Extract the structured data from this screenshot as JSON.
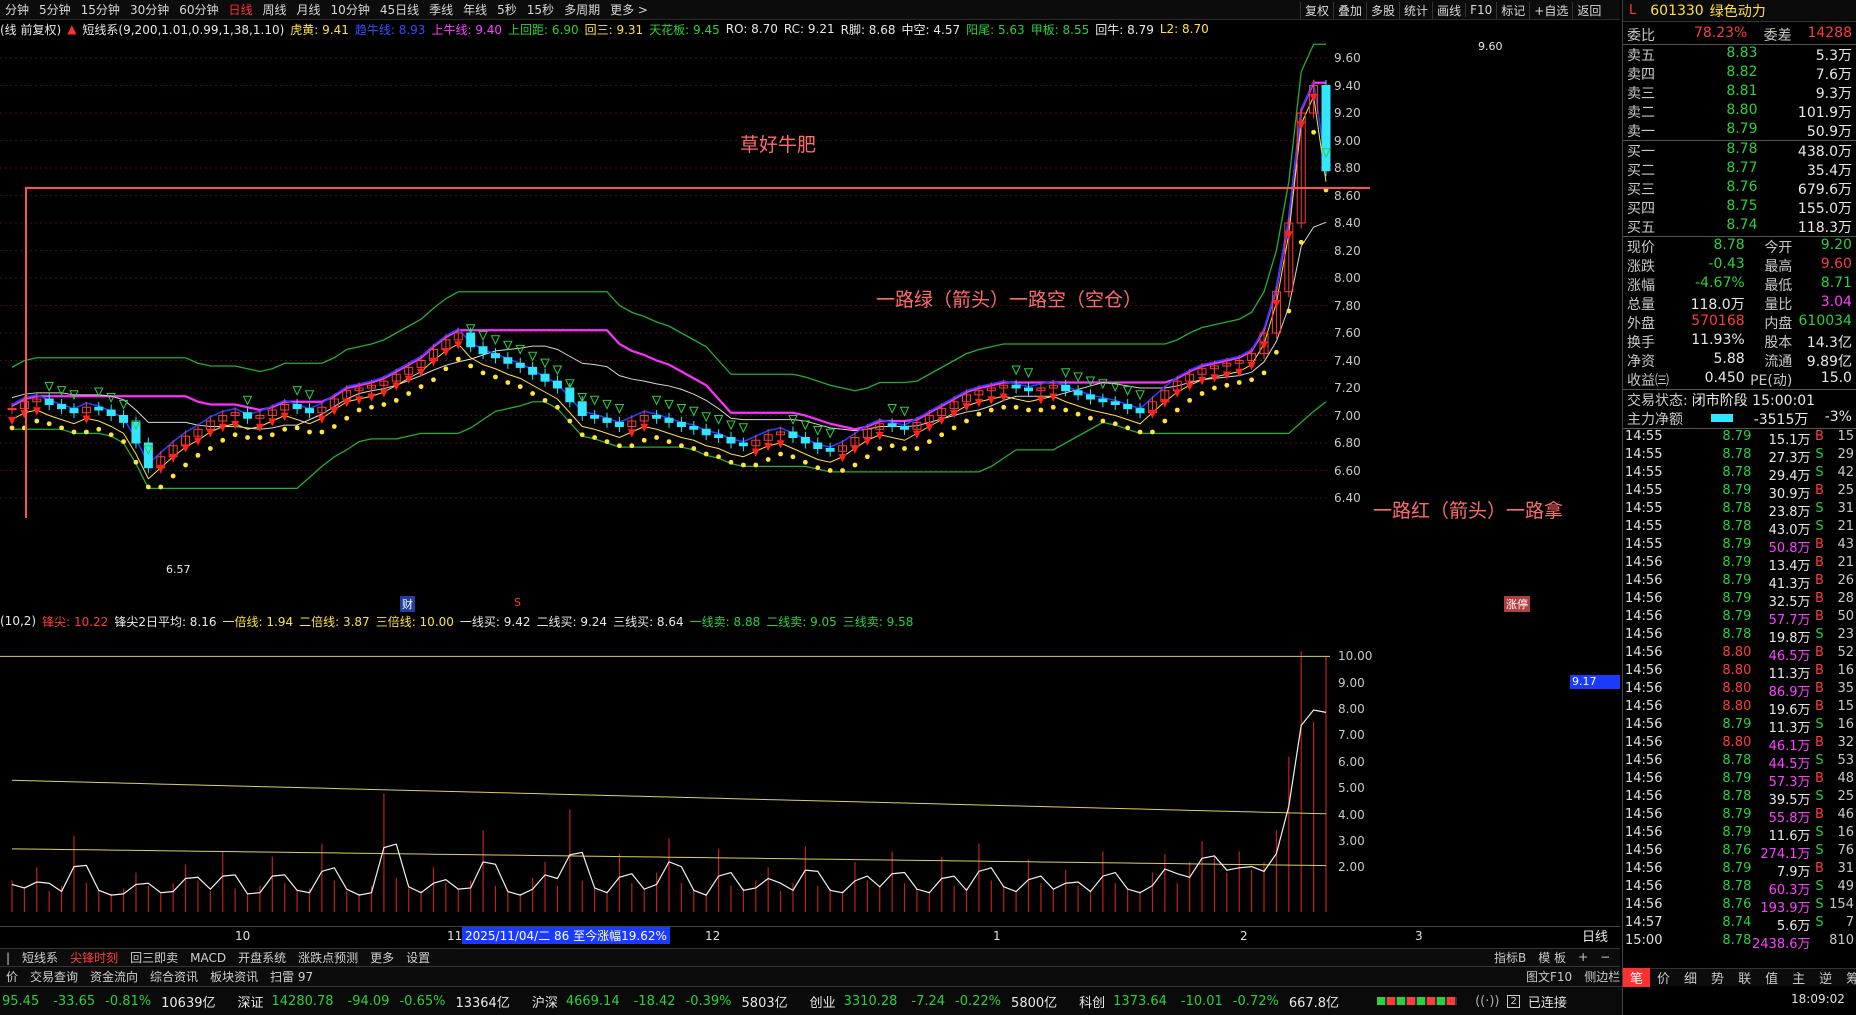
{
  "topbar": {
    "periods": [
      "分钟",
      "5分钟",
      "15分钟",
      "30分钟",
      "60分钟",
      "日线",
      "周线",
      "月线",
      "10分钟",
      "45日线",
      "季线",
      "年线",
      "5秒",
      "15秒",
      "多周期",
      "更多 >"
    ],
    "active_period": "日线",
    "right_tools": [
      "复权",
      "叠加",
      "多股",
      "统计",
      "画线",
      "F10",
      "标记",
      "+自选",
      "返回"
    ]
  },
  "main_indicator": {
    "prefix": "(线 前复权)",
    "name": "短线系(9,200,1.01,0.99,1,38,1.10)",
    "items": [
      {
        "label": "虎黄:",
        "value": "9.41",
        "color": "#ffe33b"
      },
      {
        "label": "趋牛线:",
        "value": "8.93",
        "color": "#3050ff"
      },
      {
        "label": "上牛线:",
        "value": "9.40",
        "color": "#ff40ff"
      },
      {
        "label": "上回距:",
        "value": "6.90",
        "color": "#28d23c"
      },
      {
        "label": "回三:",
        "value": "9.31",
        "color": "#ffe33b"
      },
      {
        "label": "天花板:",
        "value": "9.45",
        "color": "#28d23c"
      },
      {
        "label": "RO:",
        "value": "8.70",
        "color": "#e8e8e8"
      },
      {
        "label": "RC:",
        "value": "9.21",
        "color": "#e8e8e8"
      },
      {
        "label": "R脚:",
        "value": "8.68",
        "color": "#e8e8e8"
      },
      {
        "label": "中空:",
        "value": "4.57",
        "color": "#e8e8e8"
      },
      {
        "label": "阳尾:",
        "value": "5.63",
        "color": "#28d23c"
      },
      {
        "label": "甲板:",
        "value": "8.55",
        "color": "#28d23c"
      },
      {
        "label": "回牛:",
        "value": "8.79",
        "color": "#e8e8e8"
      },
      {
        "label": "L2:",
        "value": "8.70",
        "color": "#ffe33b"
      }
    ]
  },
  "annotations": {
    "title": "草好牛肥",
    "green_text": "一路绿（箭头）一路空（空仓）",
    "red_text": "一路红（箭头）一路拿",
    "high_label": "9.60",
    "low_label": "6.57",
    "limit_tag": "涨停",
    "cai": "财",
    "s_mark": "S"
  },
  "price_axis": [
    "9.60",
    "9.40",
    "9.20",
    "9.00",
    "8.80",
    "8.60",
    "8.40",
    "8.20",
    "8.00",
    "7.80",
    "7.60",
    "7.40",
    "7.20",
    "7.00",
    "6.80",
    "6.60",
    "6.40"
  ],
  "sub_indicator": {
    "prefix": "(10,2)",
    "items": [
      {
        "label": "锋尖:",
        "value": "10.22",
        "color": "#ff3b3b"
      },
      {
        "label": "锋尖2日平均:",
        "value": "8.16",
        "color": "#e8e8e8"
      },
      {
        "label": "一倍线:",
        "value": "1.94",
        "color": "#ffe33b"
      },
      {
        "label": "二倍线:",
        "value": "3.87",
        "color": "#ffe33b"
      },
      {
        "label": "三倍线:",
        "value": "10.00",
        "color": "#ffe33b"
      },
      {
        "label": "一线买:",
        "value": "9.42",
        "color": "#e8e8e8"
      },
      {
        "label": "二线买:",
        "value": "9.24",
        "color": "#e8e8e8"
      },
      {
        "label": "三线买:",
        "value": "8.64",
        "color": "#e8e8e8"
      },
      {
        "label": "一线卖:",
        "value": "8.88",
        "color": "#28d23c"
      },
      {
        "label": "二线卖:",
        "value": "9.05",
        "color": "#28d23c"
      },
      {
        "label": "三线卖:",
        "value": "9.58",
        "color": "#28d23c"
      }
    ],
    "axis": [
      "10.00",
      "9.00",
      "8.00",
      "7.00",
      "6.00",
      "5.00",
      "4.00",
      "3.00",
      "2.00"
    ],
    "current": "9.17"
  },
  "xaxis": {
    "months": [
      "10",
      "11",
      "12",
      "1",
      "2",
      "3"
    ],
    "info": "2025/11/04/二 86 至今涨幅19.62%",
    "period_label": "日线"
  },
  "bottom_tabs1": [
    "短线系",
    "尖锋时刻",
    "回三即卖",
    "MACD",
    "开盘系统",
    "涨跌点预测",
    "更多",
    "设置"
  ],
  "bottom_tabs1_active": "尖锋时刻",
  "bottom_tabs1_right": [
    "指标B",
    "模 板",
    "+",
    "−"
  ],
  "bottom_tabs2": [
    "价",
    "交易查询",
    "资金流向",
    "综合资讯",
    "板块资讯",
    "扫雷 97"
  ],
  "bottom_tabs2_right": [
    "图文F10",
    "侧边栏"
  ],
  "quote": {
    "code": "601330",
    "name": "绿色动力",
    "webi": {
      "label": "委比",
      "value": "78.23%",
      "diff_label": "委差",
      "diff": "14288"
    },
    "asks": [
      {
        "label": "卖五",
        "price": "8.83",
        "vol": "5.3万"
      },
      {
        "label": "卖四",
        "price": "8.82",
        "vol": "7.6万"
      },
      {
        "label": "卖三",
        "price": "8.81",
        "vol": "9.3万"
      },
      {
        "label": "卖二",
        "price": "8.80",
        "vol": "101.9万"
      },
      {
        "label": "卖一",
        "price": "8.79",
        "vol": "50.9万"
      }
    ],
    "bids": [
      {
        "label": "买一",
        "price": "8.78",
        "vol": "438.0万"
      },
      {
        "label": "买二",
        "price": "8.77",
        "vol": "35.4万"
      },
      {
        "label": "买三",
        "price": "8.76",
        "vol": "679.6万"
      },
      {
        "label": "买四",
        "price": "8.75",
        "vol": "155.0万"
      },
      {
        "label": "买五",
        "price": "8.74",
        "vol": "118.3万"
      }
    ],
    "stats": [
      [
        "现价",
        "8.78",
        "今开",
        "9.20"
      ],
      [
        "涨跌",
        "-0.43",
        "最高",
        "9.60"
      ],
      [
        "涨幅",
        "-4.67%",
        "最低",
        "8.71"
      ],
      [
        "总量",
        "118.0万",
        "量比",
        "3.04"
      ],
      [
        "外盘",
        "570168",
        "内盘",
        "610034"
      ],
      [
        "换手",
        "11.93%",
        "股本",
        "14.3亿"
      ],
      [
        "净资",
        "5.88",
        "流通",
        "9.89亿"
      ],
      [
        "收益㈢",
        "0.450",
        "PE(动)",
        "15.0"
      ]
    ],
    "status_label": "交易状态:",
    "status": "闭市阶段 15:00:01",
    "main_flow_label": "主力净额",
    "main_flow": "-3515万",
    "main_flow_pct": "-3%",
    "ticks": [
      [
        "14:55",
        "8.79",
        "15.1万",
        "B",
        "15"
      ],
      [
        "14:55",
        "8.78",
        "27.3万",
        "S",
        "29"
      ],
      [
        "14:55",
        "8.78",
        "29.4万",
        "S",
        "42"
      ],
      [
        "14:55",
        "8.79",
        "30.9万",
        "B",
        "25"
      ],
      [
        "14:55",
        "8.78",
        "23.8万",
        "S",
        "31"
      ],
      [
        "14:55",
        "8.78",
        "43.0万",
        "S",
        "21"
      ],
      [
        "14:55",
        "8.79",
        "50.8万",
        "B",
        "43"
      ],
      [
        "14:56",
        "8.79",
        "13.4万",
        "B",
        "21"
      ],
      [
        "14:56",
        "8.79",
        "41.3万",
        "B",
        "26"
      ],
      [
        "14:56",
        "8.79",
        "32.5万",
        "B",
        "28"
      ],
      [
        "14:56",
        "8.79",
        "57.7万",
        "B",
        "50"
      ],
      [
        "14:56",
        "8.78",
        "19.8万",
        "S",
        "23"
      ],
      [
        "14:56",
        "8.80",
        "46.5万",
        "B",
        "52"
      ],
      [
        "14:56",
        "8.80",
        "11.3万",
        "B",
        "16"
      ],
      [
        "14:56",
        "8.80",
        "86.9万",
        "B",
        "35"
      ],
      [
        "14:56",
        "8.80",
        "19.6万",
        "B",
        "15"
      ],
      [
        "14:56",
        "8.79",
        "11.3万",
        "S",
        "16"
      ],
      [
        "14:56",
        "8.80",
        "46.1万",
        "B",
        "32"
      ],
      [
        "14:56",
        "8.78",
        "44.5万",
        "S",
        "53"
      ],
      [
        "14:56",
        "8.79",
        "57.3万",
        "B",
        "48"
      ],
      [
        "14:56",
        "8.78",
        "39.5万",
        "S",
        "25"
      ],
      [
        "14:56",
        "8.79",
        "55.8万",
        "B",
        "46"
      ],
      [
        "14:56",
        "8.79",
        "11.6万",
        "S",
        "16"
      ],
      [
        "14:56",
        "8.76",
        "274.1万",
        "S",
        "76"
      ],
      [
        "14:56",
        "8.79",
        "7.9万",
        "B",
        "31"
      ],
      [
        "14:56",
        "8.78",
        "60.3万",
        "S",
        "49"
      ],
      [
        "14:56",
        "8.76",
        "193.9万",
        "S",
        "154"
      ],
      [
        "14:57",
        "8.74",
        "5.6万",
        "S",
        "7"
      ],
      [
        "15:00",
        "8.78",
        "2438.6万",
        "",
        "810"
      ]
    ],
    "bottom_tabs": [
      "笔",
      "价",
      "细",
      "势",
      "联",
      "值",
      "主",
      "逆",
      "筹"
    ]
  },
  "indices": [
    {
      "name": "",
      "value": "95.45",
      "chg": "-33.65",
      "pct": "-0.81%",
      "amt": "10639亿"
    },
    {
      "name": "深证",
      "value": "14280.78",
      "chg": "-94.09",
      "pct": "-0.65%",
      "amt": "13364亿"
    },
    {
      "name": "沪深",
      "value": "4669.14",
      "chg": "-18.42",
      "pct": "-0.39%",
      "amt": "5803亿"
    },
    {
      "name": "创业",
      "value": "3310.28",
      "chg": "-7.24",
      "pct": "-0.22%",
      "amt": "5800亿"
    },
    {
      "name": "科创",
      "value": "1373.64",
      "chg": "-10.01",
      "pct": "-0.72%",
      "amt": "667.8亿"
    }
  ],
  "connection": "已连接",
  "clock": "18:09:02",
  "chart_data": {
    "type": "line",
    "title": "",
    "price_range": [
      6.4,
      9.6
    ],
    "closes": [
      7.05,
      7.1,
      7.12,
      7.08,
      7.05,
      7.02,
      7.06,
      7.04,
      7.0,
      6.95,
      6.8,
      6.62,
      6.7,
      6.78,
      6.85,
      6.9,
      6.96,
      7.0,
      7.02,
      6.98,
      7.0,
      7.04,
      7.08,
      7.05,
      7.02,
      7.06,
      7.12,
      7.18,
      7.2,
      7.22,
      7.25,
      7.3,
      7.35,
      7.4,
      7.48,
      7.55,
      7.6,
      7.5,
      7.45,
      7.42,
      7.38,
      7.35,
      7.3,
      7.25,
      7.2,
      7.1,
      7.0,
      6.98,
      6.95,
      6.92,
      6.96,
      7.0,
      6.98,
      6.95,
      6.92,
      6.9,
      6.86,
      6.84,
      6.8,
      6.78,
      6.82,
      6.86,
      6.88,
      6.84,
      6.8,
      6.76,
      6.74,
      6.78,
      6.84,
      6.9,
      6.94,
      6.92,
      6.9,
      6.95,
      7.0,
      7.05,
      7.1,
      7.15,
      7.18,
      7.2,
      7.22,
      7.2,
      7.18,
      7.2,
      7.22,
      7.18,
      7.15,
      7.12,
      7.1,
      7.08,
      7.05,
      7.02,
      7.1,
      7.18,
      7.25,
      7.3,
      7.34,
      7.36,
      7.38,
      7.4,
      7.45,
      7.6,
      7.9,
      8.4,
      9.2,
      9.4,
      8.78
    ],
    "peak_series": [
      1.5,
      1.2,
      2.0,
      1.1,
      1.3,
      3.2,
      1.4,
      1.1,
      1.0,
      1.2,
      1.8,
      1.3,
      1.0,
      1.4,
      2.1,
      1.5,
      1.1,
      2.6,
      1.2,
      1.0,
      1.3,
      2.4,
      1.4,
      1.1,
      1.2,
      2.9,
      1.5,
      1.1,
      1.0,
      1.3,
      4.8,
      1.6,
      1.2,
      1.1,
      2.0,
      1.4,
      1.2,
      1.5,
      3.4,
      1.3,
      1.1,
      1.0,
      1.6,
      2.2,
      1.3,
      4.2,
      1.5,
      1.2,
      1.1,
      2.5,
      1.4,
      1.2,
      1.8,
      3.1,
      1.4,
      1.1,
      1.0,
      2.7,
      1.3,
      1.2,
      1.5,
      2.0,
      1.1,
      1.4,
      2.8,
      1.3,
      1.2,
      1.1,
      2.2,
      1.5,
      1.3,
      2.6,
      1.4,
      1.2,
      1.1,
      2.4,
      1.3,
      1.2,
      2.9,
      1.5,
      1.3,
      1.1,
      2.3,
      1.4,
      1.2,
      1.9,
      1.3,
      1.1,
      2.6,
      1.4,
      1.2,
      1.1,
      1.8,
      2.5,
      1.4,
      2.2,
      3.0,
      2.4,
      1.8,
      2.6,
      1.9,
      2.2,
      3.4,
      6.2,
      10.2,
      7.5,
      10.0
    ]
  }
}
